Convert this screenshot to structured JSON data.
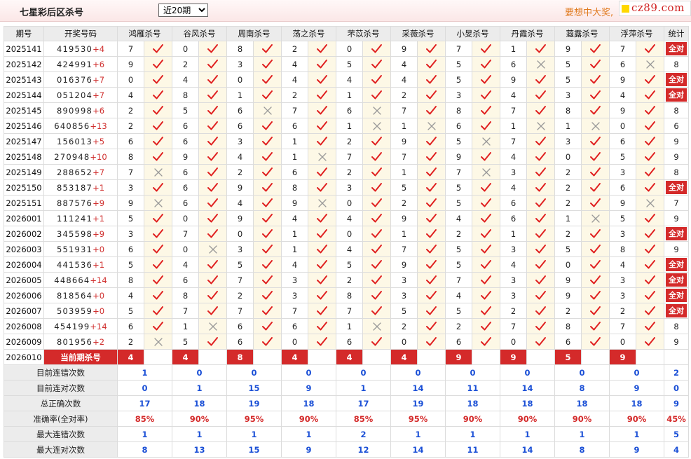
{
  "header": {
    "title": "七星彩后区杀号",
    "period_select": "近20期",
    "promo": "要想中大奖,",
    "logo": "cz89.com"
  },
  "columns": {
    "period": "期号",
    "numbers": "开奖号码",
    "experts": [
      "鸿雁杀号",
      "谷风杀号",
      "周南杀号",
      "荡之杀号",
      "芣苡杀号",
      "采薇杀号",
      "小旻杀号",
      "丹霞杀号",
      "蕸露杀号",
      "浮萍杀号"
    ],
    "stat": "统计"
  },
  "rows": [
    {
      "period": "2025141",
      "front": "419530",
      "back": "+4",
      "preds": [
        "7",
        "0",
        "8",
        "2",
        "0",
        "9",
        "7",
        "1",
        "9",
        "7"
      ],
      "hits": [
        1,
        1,
        1,
        1,
        1,
        1,
        1,
        1,
        1,
        1
      ],
      "stat": "全对"
    },
    {
      "period": "2025142",
      "front": "424991",
      "back": "+6",
      "preds": [
        "9",
        "2",
        "3",
        "4",
        "5",
        "4",
        "5",
        "6",
        "5",
        "6"
      ],
      "hits": [
        1,
        1,
        1,
        1,
        1,
        1,
        1,
        0,
        1,
        0
      ],
      "stat": "8"
    },
    {
      "period": "2025143",
      "front": "016376",
      "back": "+7",
      "preds": [
        "0",
        "4",
        "0",
        "4",
        "4",
        "4",
        "5",
        "9",
        "5",
        "9"
      ],
      "hits": [
        1,
        1,
        1,
        1,
        1,
        1,
        1,
        1,
        1,
        1
      ],
      "stat": "全对"
    },
    {
      "period": "2025144",
      "front": "051204",
      "back": "+7",
      "preds": [
        "4",
        "8",
        "1",
        "2",
        "1",
        "2",
        "3",
        "4",
        "3",
        "4"
      ],
      "hits": [
        1,
        1,
        1,
        1,
        1,
        1,
        1,
        1,
        1,
        1
      ],
      "stat": "全对"
    },
    {
      "period": "2025145",
      "front": "890998",
      "back": "+6",
      "preds": [
        "2",
        "5",
        "6",
        "7",
        "6",
        "7",
        "8",
        "7",
        "8",
        "9"
      ],
      "hits": [
        1,
        1,
        0,
        1,
        0,
        1,
        1,
        1,
        1,
        1
      ],
      "stat": "8"
    },
    {
      "period": "2025146",
      "front": "640856",
      "back": "+13",
      "preds": [
        "2",
        "6",
        "6",
        "6",
        "1",
        "1",
        "6",
        "1",
        "1",
        "0"
      ],
      "hits": [
        1,
        1,
        1,
        1,
        0,
        0,
        1,
        0,
        0,
        1
      ],
      "stat": "6"
    },
    {
      "period": "2025147",
      "front": "156013",
      "back": "+5",
      "preds": [
        "6",
        "6",
        "3",
        "1",
        "2",
        "9",
        "5",
        "7",
        "3",
        "6"
      ],
      "hits": [
        1,
        1,
        1,
        1,
        1,
        1,
        0,
        1,
        1,
        1
      ],
      "stat": "9"
    },
    {
      "period": "2025148",
      "front": "270948",
      "back": "+10",
      "preds": [
        "8",
        "9",
        "4",
        "1",
        "7",
        "7",
        "9",
        "4",
        "0",
        "5"
      ],
      "hits": [
        1,
        1,
        1,
        0,
        1,
        1,
        1,
        1,
        1,
        1
      ],
      "stat": "9"
    },
    {
      "period": "2025149",
      "front": "288652",
      "back": "+7",
      "preds": [
        "7",
        "6",
        "2",
        "6",
        "2",
        "1",
        "7",
        "3",
        "2",
        "3"
      ],
      "hits": [
        0,
        1,
        1,
        1,
        1,
        1,
        0,
        1,
        1,
        1
      ],
      "stat": "8"
    },
    {
      "period": "2025150",
      "front": "853187",
      "back": "+1",
      "preds": [
        "3",
        "6",
        "9",
        "8",
        "3",
        "5",
        "5",
        "4",
        "2",
        "6"
      ],
      "hits": [
        1,
        1,
        1,
        1,
        1,
        1,
        1,
        1,
        1,
        1
      ],
      "stat": "全对"
    },
    {
      "period": "2025151",
      "front": "887576",
      "back": "+9",
      "preds": [
        "9",
        "6",
        "4",
        "9",
        "0",
        "2",
        "5",
        "6",
        "2",
        "9"
      ],
      "hits": [
        0,
        1,
        1,
        0,
        1,
        1,
        1,
        1,
        1,
        0
      ],
      "stat": "7"
    },
    {
      "period": "2026001",
      "front": "111241",
      "back": "+1",
      "preds": [
        "5",
        "0",
        "9",
        "4",
        "4",
        "9",
        "4",
        "6",
        "1",
        "5"
      ],
      "hits": [
        1,
        1,
        1,
        1,
        1,
        1,
        1,
        1,
        0,
        1
      ],
      "stat": "9"
    },
    {
      "period": "2026002",
      "front": "345598",
      "back": "+9",
      "preds": [
        "3",
        "7",
        "0",
        "1",
        "0",
        "1",
        "2",
        "1",
        "2",
        "3"
      ],
      "hits": [
        1,
        1,
        1,
        1,
        1,
        1,
        1,
        1,
        1,
        1
      ],
      "stat": "全对"
    },
    {
      "period": "2026003",
      "front": "551931",
      "back": "+0",
      "preds": [
        "6",
        "0",
        "3",
        "1",
        "4",
        "7",
        "5",
        "3",
        "5",
        "8"
      ],
      "hits": [
        1,
        0,
        1,
        1,
        1,
        1,
        1,
        1,
        1,
        1
      ],
      "stat": "9"
    },
    {
      "period": "2026004",
      "front": "441536",
      "back": "+1",
      "preds": [
        "5",
        "4",
        "5",
        "4",
        "5",
        "9",
        "5",
        "4",
        "0",
        "4"
      ],
      "hits": [
        1,
        1,
        1,
        1,
        1,
        1,
        1,
        1,
        1,
        1
      ],
      "stat": "全对"
    },
    {
      "period": "2026005",
      "front": "448664",
      "back": "+14",
      "preds": [
        "8",
        "6",
        "7",
        "3",
        "2",
        "3",
        "7",
        "3",
        "9",
        "3"
      ],
      "hits": [
        1,
        1,
        1,
        1,
        1,
        1,
        1,
        1,
        1,
        1
      ],
      "stat": "全对"
    },
    {
      "period": "2026006",
      "front": "818564",
      "back": "+0",
      "preds": [
        "4",
        "8",
        "2",
        "3",
        "8",
        "3",
        "4",
        "3",
        "9",
        "3"
      ],
      "hits": [
        1,
        1,
        1,
        1,
        1,
        1,
        1,
        1,
        1,
        1
      ],
      "stat": "全对"
    },
    {
      "period": "2026007",
      "front": "503959",
      "back": "+0",
      "preds": [
        "5",
        "7",
        "7",
        "7",
        "7",
        "5",
        "5",
        "2",
        "2",
        "2"
      ],
      "hits": [
        1,
        1,
        1,
        1,
        1,
        1,
        1,
        1,
        1,
        1
      ],
      "stat": "全对"
    },
    {
      "period": "2026008",
      "front": "454199",
      "back": "+14",
      "preds": [
        "6",
        "1",
        "6",
        "6",
        "1",
        "2",
        "2",
        "7",
        "8",
        "7"
      ],
      "hits": [
        1,
        0,
        1,
        1,
        0,
        1,
        1,
        1,
        1,
        1
      ],
      "stat": "8"
    },
    {
      "period": "2026009",
      "front": "801956",
      "back": "+2",
      "preds": [
        "2",
        "5",
        "6",
        "0",
        "6",
        "0",
        "6",
        "0",
        "6",
        "0"
      ],
      "hits": [
        0,
        1,
        1,
        1,
        1,
        1,
        1,
        1,
        1,
        1
      ],
      "stat": "9"
    }
  ],
  "current": {
    "period": "2026010",
    "label": "当前期杀号",
    "preds": [
      "4",
      "4",
      "8",
      "4",
      "4",
      "4",
      "9",
      "9",
      "5",
      "9"
    ]
  },
  "summary": [
    {
      "label": "目前连错次数",
      "values": [
        "1",
        "0",
        "0",
        "0",
        "0",
        "0",
        "0",
        "0",
        "0",
        "0"
      ],
      "stat": "2",
      "red": false
    },
    {
      "label": "目前连对次数",
      "values": [
        "0",
        "1",
        "15",
        "9",
        "1",
        "14",
        "11",
        "14",
        "8",
        "9"
      ],
      "stat": "0",
      "red": false
    },
    {
      "label": "总正确次数",
      "values": [
        "17",
        "18",
        "19",
        "18",
        "17",
        "19",
        "18",
        "18",
        "18",
        "18"
      ],
      "stat": "9",
      "red": false
    },
    {
      "label": "准确率(全对率)",
      "values": [
        "85%",
        "90%",
        "95%",
        "90%",
        "85%",
        "95%",
        "90%",
        "90%",
        "90%",
        "90%"
      ],
      "stat": "45%",
      "red": true
    },
    {
      "label": "最大连错次数",
      "values": [
        "1",
        "1",
        "1",
        "1",
        "2",
        "1",
        "1",
        "1",
        "1",
        "1"
      ],
      "stat": "5",
      "red": false
    },
    {
      "label": "最大连对次数",
      "values": [
        "8",
        "13",
        "15",
        "9",
        "12",
        "14",
        "11",
        "14",
        "8",
        "9"
      ],
      "stat": "4",
      "red": false
    }
  ],
  "icons": {
    "hit": "check-icon",
    "miss": "cross-icon"
  },
  "colors": {
    "accent_red": "#d42a2a",
    "check": "#e02020",
    "miss": "#999999",
    "value_blue": "#1a4fd6",
    "promo": "#e07a1f",
    "cell_bg": "#fdf8e6"
  }
}
